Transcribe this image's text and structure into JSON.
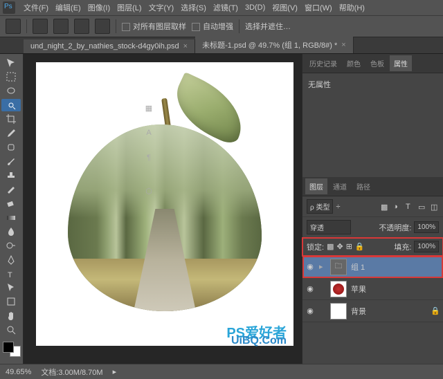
{
  "menu": {
    "items": [
      "文件(F)",
      "编辑(E)",
      "图像(I)",
      "图层(L)",
      "文字(Y)",
      "选择(S)",
      "滤镜(T)",
      "3D(D)",
      "视图(V)",
      "窗口(W)",
      "帮助(H)"
    ]
  },
  "options": {
    "sample_all": "对所有图层取样",
    "auto_enhance": "自动增强",
    "refine": "选择并遮住…"
  },
  "tabs": {
    "one": "und_night_2_by_nathies_stock-d4gy0ih.psd",
    "two": "未标题-1.psd @ 49.7% (组 1, RGB/8#) *"
  },
  "panels": {
    "history": "历史记录",
    "color": "颜色",
    "swatch": "色板",
    "properties": "属性",
    "no_prop": "无属性",
    "layers": "图层",
    "channels": "通道",
    "paths": "路径",
    "kind": "ρ 类型",
    "blend": "穿透",
    "opacity_lbl": "不透明度:",
    "opacity_val": "100%",
    "lock_lbl": "锁定:",
    "fill_lbl": "填充:",
    "fill_val": "100%"
  },
  "layers": {
    "group": "组 1",
    "apple": "苹果",
    "bg": "背景"
  },
  "status": {
    "zoom": "49.65%",
    "doc": "文档:3.00M/8.70M"
  },
  "watermark": {
    "text": "UiBQ.Com",
    "prefix": "PS爱好者"
  },
  "icons": {
    "close": "×",
    "eye": "◉",
    "chevron": "▸",
    "lock": "🔒",
    "dropdown": "÷"
  }
}
